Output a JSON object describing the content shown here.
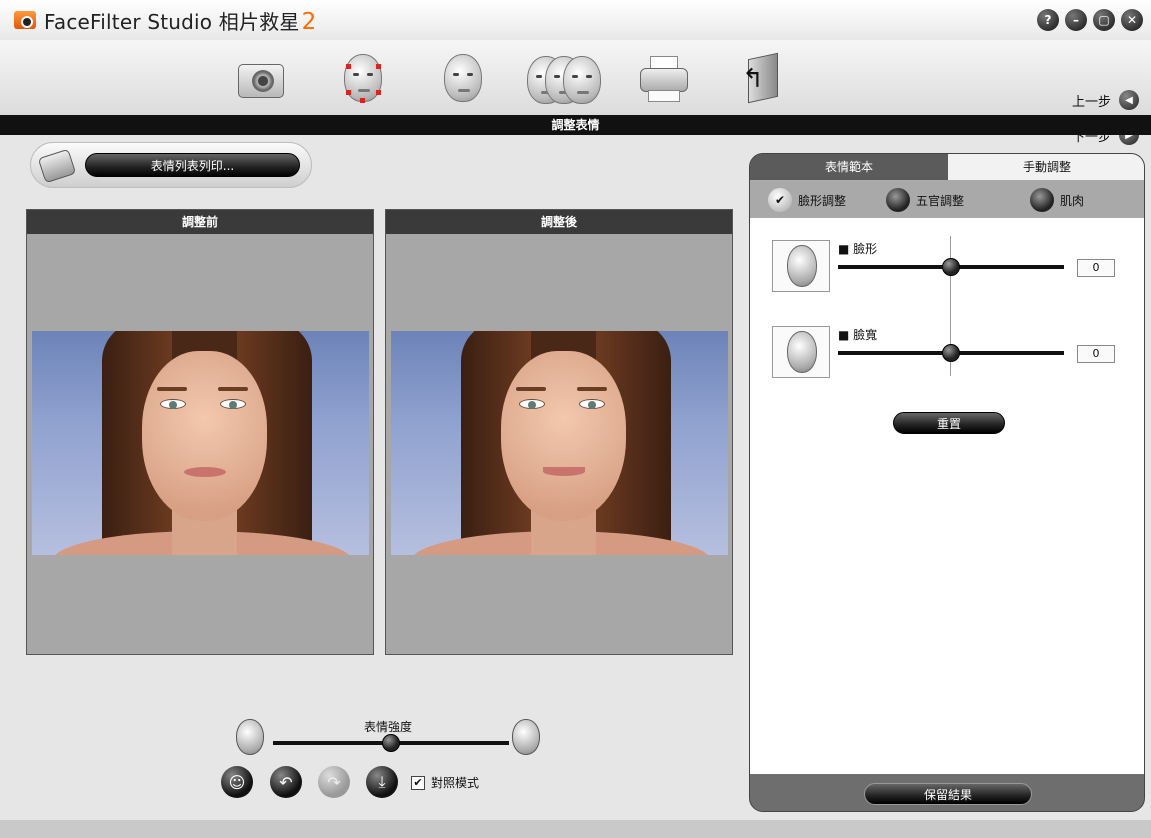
{
  "app": {
    "title": "FaceFilter Studio 相片救星",
    "version": "2",
    "window_buttons": [
      "?",
      "–",
      "▢",
      "✕"
    ]
  },
  "toolbar": {
    "tools": [
      {
        "icon": "camera-icon"
      },
      {
        "icon": "face-points-icon"
      },
      {
        "icon": "face-blend-icon"
      },
      {
        "icon": "face-expression-icon"
      },
      {
        "icon": "printer-icon"
      },
      {
        "icon": "exit-door-icon"
      }
    ],
    "prev_label": "上一步",
    "next_label": "下一步"
  },
  "section": {
    "title": "調整表情"
  },
  "print": {
    "label": "表情列表列印..."
  },
  "panels": {
    "before_title": "調整前",
    "after_title": "調整後"
  },
  "strength": {
    "label": "表情強度",
    "value": 0.5
  },
  "bottom_controls": {
    "compare_label": "對照模式",
    "compare_checked": true
  },
  "right_panel": {
    "tabs": [
      {
        "label": "表情範本",
        "active": false
      },
      {
        "label": "手動調整",
        "active": true
      }
    ],
    "options": [
      {
        "label": "臉形調整",
        "selected": true
      },
      {
        "label": "五官調整",
        "selected": false
      },
      {
        "label": "肌肉",
        "selected": false
      }
    ],
    "sliders": [
      {
        "label": "■ 臉形",
        "value": "0"
      },
      {
        "label": "■ 臉寬",
        "value": "0"
      }
    ],
    "reset_label": "重置",
    "keep_label": "保留結果"
  }
}
